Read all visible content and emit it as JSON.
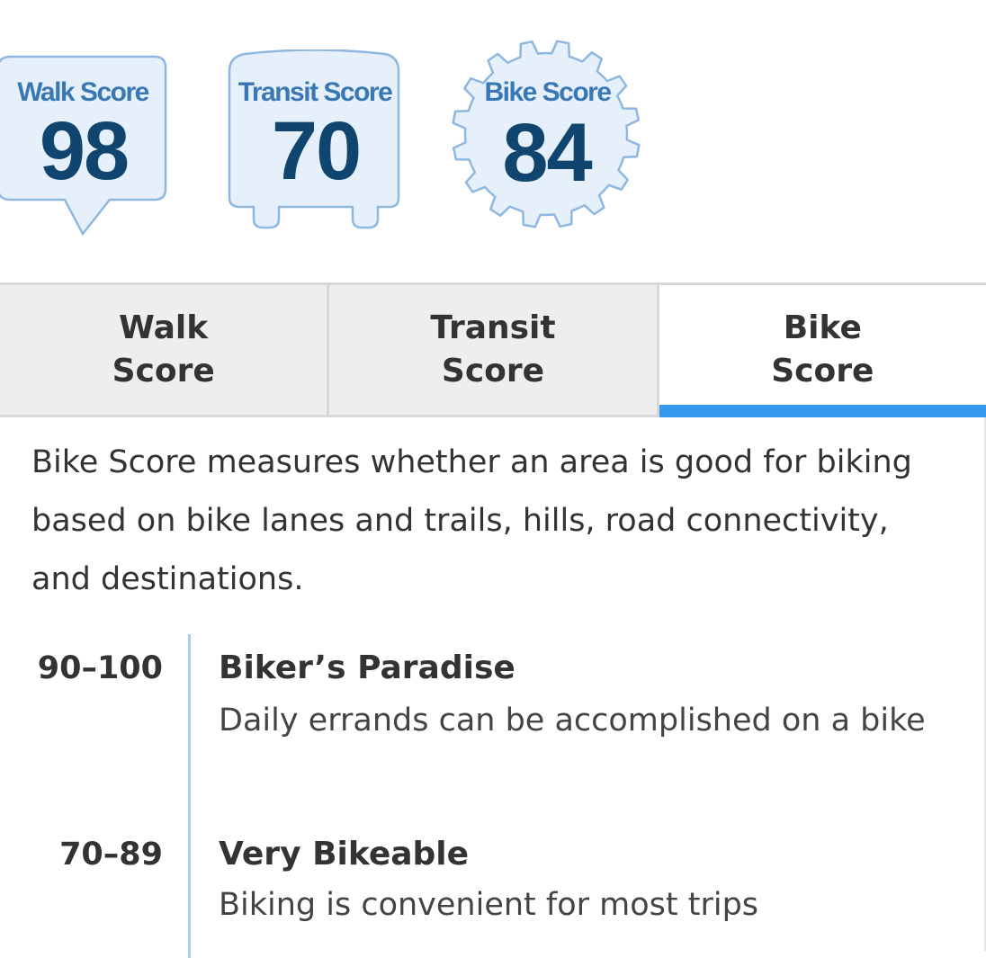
{
  "badges": {
    "walk": {
      "label": "Walk Score",
      "value": "98"
    },
    "transit": {
      "label": "Transit Score",
      "value": "70"
    },
    "bike": {
      "label": "Bike Score",
      "value": "84"
    }
  },
  "tabs": [
    {
      "label": "Walk Score",
      "active": false
    },
    {
      "label": "Transit Score",
      "active": false
    },
    {
      "label": "Bike Score",
      "active": true
    }
  ],
  "description": "Bike Score measures whether an area is good for biking based on bike lanes and trails, hills, road connectivity, and destinations.",
  "ranges": [
    {
      "range": "90–100",
      "title": "Biker’s Paradise",
      "desc": "Daily errands can be accomplished on a bike"
    },
    {
      "range": "70–89",
      "title": "Very Bikeable",
      "desc": "Biking is convenient for most trips"
    }
  ],
  "colors": {
    "badge_fill": "#e6f0fa",
    "badge_stroke": "#8fb7df",
    "badge_label": "#3a78b5",
    "badge_number": "#10456f",
    "tab_bg": "#eeeeee",
    "active_indicator": "#3399ee",
    "divider": "#a8cdf0"
  }
}
